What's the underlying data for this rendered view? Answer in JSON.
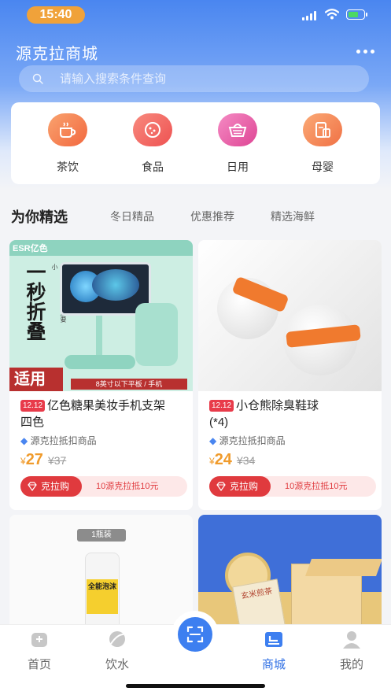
{
  "status_bar": {
    "time": "15:40"
  },
  "header": {
    "title": "源克拉商城"
  },
  "search": {
    "placeholder": "请输入搜索条件查询"
  },
  "categories": [
    {
      "label": "茶饮",
      "icon": "tea-cup-icon",
      "color": "#f47f52"
    },
    {
      "label": "食品",
      "icon": "food-bowl-icon",
      "color": "#f26b6b"
    },
    {
      "label": "日用",
      "icon": "basket-icon",
      "color": "#ec62a8"
    },
    {
      "label": "母婴",
      "icon": "baby-bottle-icon",
      "color": "#f48e58"
    }
  ],
  "section": {
    "title": "为你精选",
    "tabs": [
      "冬日精品",
      "优惠推荐",
      "精选海鲜"
    ]
  },
  "products": [
    {
      "badge": "12.12",
      "title_line1": "亿色糖果美妆手机支架",
      "title_line2": "四色",
      "tag": "源克拉抵扣商品",
      "price_symbol": "¥",
      "price": "27",
      "original_price": "¥37",
      "buy_label": "克拉购",
      "deduction": "10源克拉抵10元",
      "image": {
        "brand": "ESR亿色",
        "headline": "一秒折叠",
        "side_text": "小巧便携·比手机还要小",
        "corner": "适用",
        "bottom_text": "8英寸以下平板 / 手机"
      }
    },
    {
      "badge": "12.12",
      "title_line1": "小仓熊除臭鞋球",
      "title_line2": "(*4)",
      "tag": "源克拉抵扣商品",
      "price_symbol": "¥",
      "price": "24",
      "original_price": "¥34",
      "buy_label": "克拉购",
      "deduction": "10源克拉抵10元"
    },
    {
      "image": {
        "pack_label": "1瓶装",
        "bottle_text": "全能泡沫"
      }
    },
    {
      "image": {
        "box_text": "玄米煎茶"
      }
    }
  ],
  "bottom_nav": [
    {
      "label": "首页",
      "icon": "home-icon"
    },
    {
      "label": "饮水",
      "icon": "leaf-icon"
    },
    {
      "label": "商城",
      "icon": "store-icon",
      "active": true
    },
    {
      "label": "我的",
      "icon": "profile-icon"
    }
  ],
  "colors": {
    "primary": "#3d7ff0",
    "accent_red": "#e03a3e",
    "price_orange": "#f09b2c"
  }
}
